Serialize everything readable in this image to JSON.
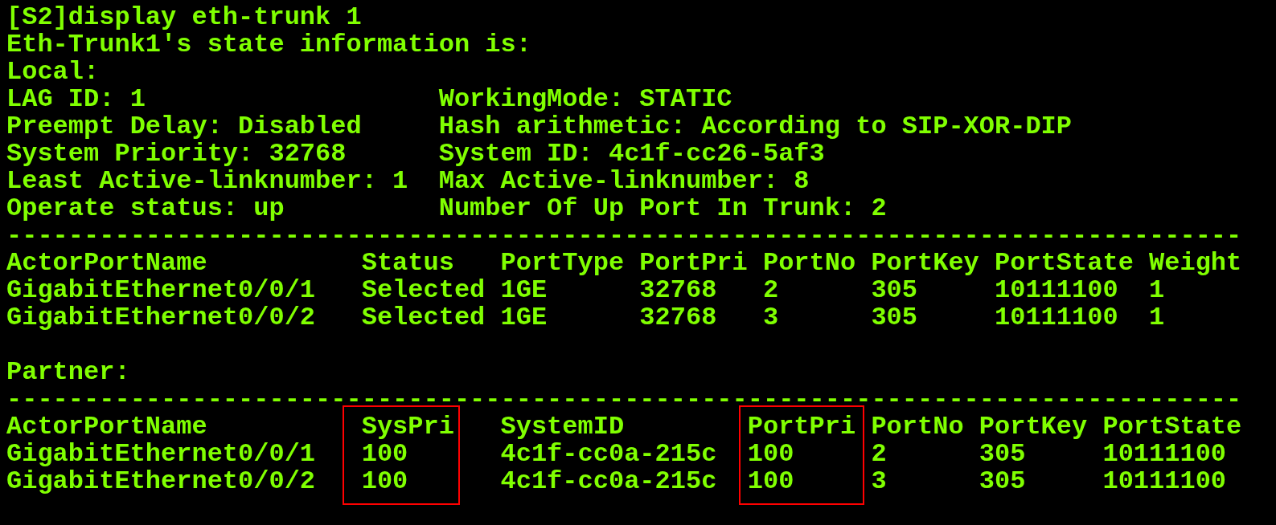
{
  "command": "[S2]display eth-trunk 1",
  "heading": "Eth-Trunk1's state information is:",
  "local": {
    "title": "Local:",
    "fields": [
      [
        "LAG ID: 1",
        "WorkingMode: STATIC"
      ],
      [
        "Preempt Delay: Disabled",
        "Hash arithmetic: According to SIP-XOR-DIP"
      ],
      [
        "System Priority: 32768",
        "System ID: 4c1f-cc26-5af3"
      ],
      [
        "Least Active-linknumber: 1",
        "Max Active-linknumber: 8"
      ],
      [
        "Operate status: up",
        "Number Of Up Port In Trunk: 2"
      ]
    ],
    "separator": "--------------------------------------------------------------------------------",
    "table": {
      "columns": [
        {
          "label": "ActorPortName",
          "highlighted": false
        },
        {
          "label": "Status",
          "highlighted": false
        },
        {
          "label": "PortType",
          "highlighted": false
        },
        {
          "label": "PortPri",
          "highlighted": false
        },
        {
          "label": "PortNo",
          "highlighted": false
        },
        {
          "label": "PortKey",
          "highlighted": false
        },
        {
          "label": "PortState",
          "highlighted": false
        },
        {
          "label": "Weight",
          "highlighted": false
        }
      ],
      "rows": [
        [
          "GigabitEthernet0/0/1",
          "Selected",
          "1GE",
          "32768",
          "2",
          "305",
          "10111100",
          "1"
        ],
        [
          "GigabitEthernet0/0/2",
          "Selected",
          "1GE",
          "32768",
          "3",
          "305",
          "10111100",
          "1"
        ]
      ]
    }
  },
  "partner": {
    "title": "Partner:",
    "separator": "--------------------------------------------------------------------------------",
    "table": {
      "columns": [
        {
          "label": "ActorPortName",
          "highlighted": false
        },
        {
          "label": "SysPri",
          "highlighted": true
        },
        {
          "label": "SystemID",
          "highlighted": false
        },
        {
          "label": "PortPri",
          "highlighted": true
        },
        {
          "label": "PortNo",
          "highlighted": false
        },
        {
          "label": "PortKey",
          "highlighted": false
        },
        {
          "label": "PortState",
          "highlighted": false
        }
      ],
      "rows": [
        [
          "GigabitEthernet0/0/1",
          "100",
          "4c1f-cc0a-215c",
          "100",
          "2",
          "305",
          "10111100"
        ],
        [
          "GigabitEthernet0/0/2",
          "100",
          "4c1f-cc0a-215c",
          "100",
          "3",
          "305",
          "10111100"
        ]
      ]
    }
  }
}
